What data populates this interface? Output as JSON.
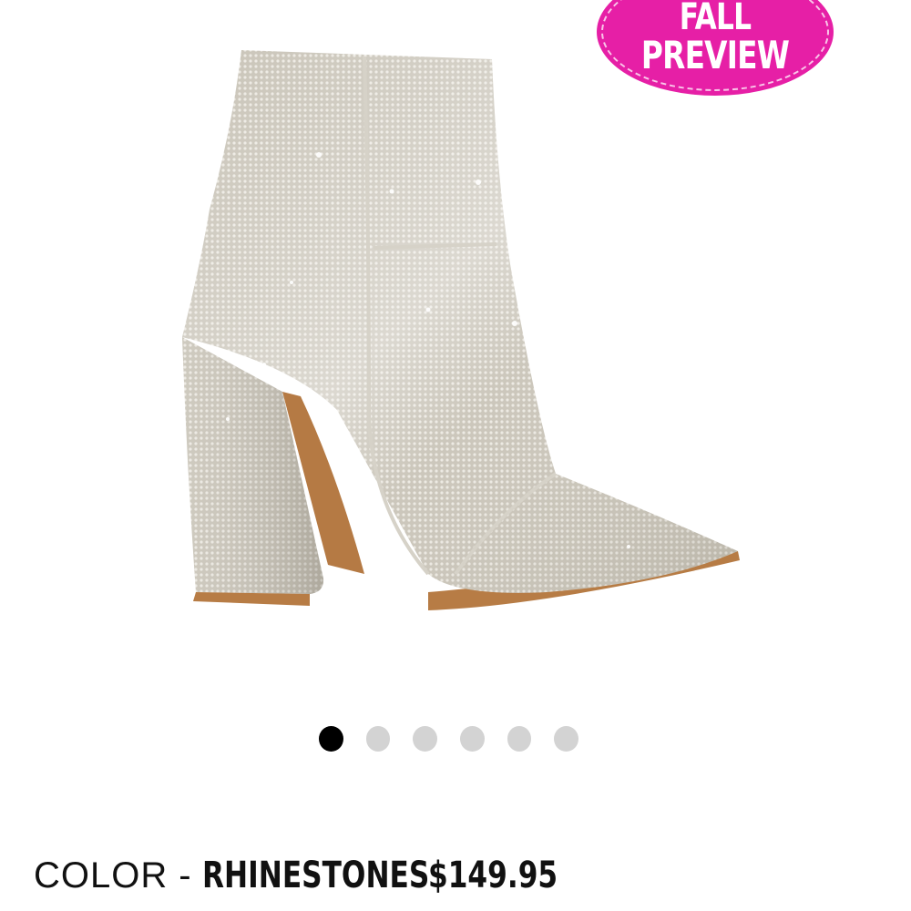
{
  "badge": {
    "line1": "FALL",
    "line2": "PREVIEW",
    "color": "#e61fa6"
  },
  "product": {
    "image_icon": "rhinestone-ankle-boot-image"
  },
  "carousel": {
    "count": 6,
    "active_index": 0
  },
  "details": {
    "color_label": "COLOR",
    "separator": "-",
    "color_value": "RHINESTONES",
    "price": "$149.95"
  }
}
